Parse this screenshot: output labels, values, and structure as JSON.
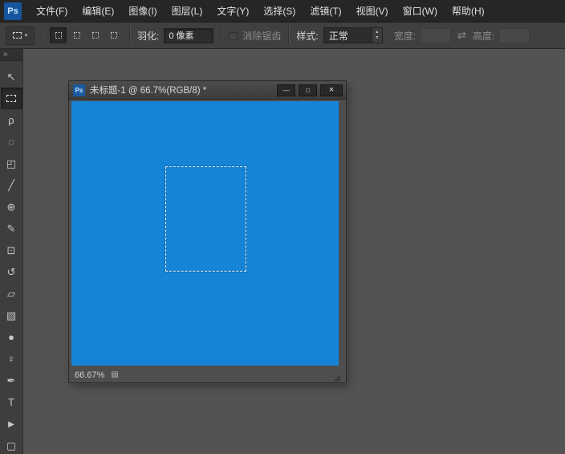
{
  "colors": {
    "canvas_blue": "#1584d6",
    "app_bg": "#535353"
  },
  "icons": {
    "caret_down": "▾",
    "spinner_up": "▴",
    "spinner_down": "▾",
    "swap": "⇄",
    "file_page": "▤",
    "resize_grip": "◢"
  },
  "menu_bar": {
    "logo": "Ps",
    "items": [
      {
        "id": "file",
        "label": "文件(F)"
      },
      {
        "id": "edit",
        "label": "编辑(E)"
      },
      {
        "id": "image",
        "label": "图像(I)"
      },
      {
        "id": "layer",
        "label": "图层(L)"
      },
      {
        "id": "type",
        "label": "文字(Y)"
      },
      {
        "id": "select",
        "label": "选择(S)"
      },
      {
        "id": "filter",
        "label": "滤镜(T)"
      },
      {
        "id": "view",
        "label": "视图(V)"
      },
      {
        "id": "window",
        "label": "窗口(W)"
      },
      {
        "id": "help",
        "label": "帮助(H)"
      }
    ]
  },
  "options_bar": {
    "feather_label": "羽化:",
    "feather_value": "0 像素",
    "antialias_label": "消除锯齿",
    "style_label": "样式:",
    "style_value": "正常",
    "width_label": "宽度:",
    "width_value": "",
    "height_label": "高度:",
    "height_value": ""
  },
  "toolbar": {
    "collapse_glyph": "»",
    "tools": [
      {
        "id": "move",
        "glyph": "↖",
        "selected": false
      },
      {
        "id": "rect-marquee",
        "glyph": "",
        "selected": true
      },
      {
        "id": "lasso",
        "glyph": "ρ",
        "selected": false
      },
      {
        "id": "quick-select",
        "glyph": "◌",
        "selected": false
      },
      {
        "id": "crop",
        "glyph": "◰",
        "selected": false
      },
      {
        "id": "eyedropper",
        "glyph": "╱",
        "selected": false
      },
      {
        "id": "healing-brush",
        "glyph": "⊕",
        "selected": false
      },
      {
        "id": "brush",
        "glyph": "✎",
        "selected": false
      },
      {
        "id": "clone-stamp",
        "glyph": "⊡",
        "selected": false
      },
      {
        "id": "history-brush",
        "glyph": "↺",
        "selected": false
      },
      {
        "id": "eraser",
        "glyph": "▱",
        "selected": false
      },
      {
        "id": "gradient",
        "glyph": "▧",
        "selected": false
      },
      {
        "id": "blur",
        "glyph": "●",
        "selected": false
      },
      {
        "id": "dodge",
        "glyph": "♀",
        "selected": false
      },
      {
        "id": "pen",
        "glyph": "✒",
        "selected": false
      },
      {
        "id": "text",
        "glyph": "T",
        "selected": false
      },
      {
        "id": "path-select",
        "glyph": "►",
        "selected": false
      },
      {
        "id": "shape",
        "glyph": "▢",
        "selected": false
      }
    ]
  },
  "document_window": {
    "icon": "Ps",
    "title": "未标题-1 @ 66.7%(RGB/8) *",
    "controls": {
      "minimize": "—",
      "maximize": "□",
      "close": "×"
    },
    "status": {
      "zoom": "66.67%"
    }
  }
}
